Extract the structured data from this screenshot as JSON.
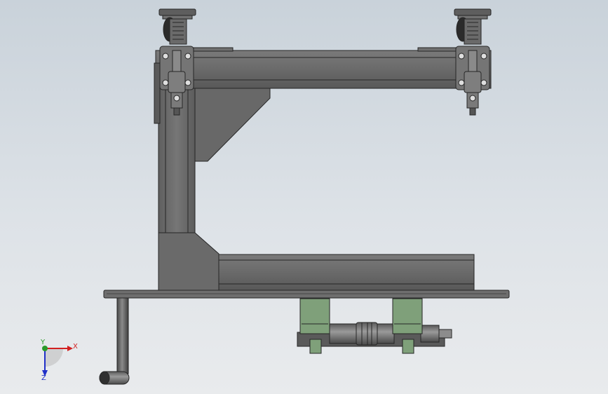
{
  "viewport": {
    "background_top": "#c9d2da",
    "background_bottom": "#e9ebed"
  },
  "model": {
    "part_color": "#6b6b6b",
    "part_edge": "#2a2a2a",
    "clamp_color": "#7fa07a"
  },
  "triad": {
    "x_label": "X",
    "y_label": "Y",
    "z_label": "Z",
    "x_color": "#d22020",
    "y_color": "#2a9a2a",
    "z_color": "#2030c8"
  }
}
